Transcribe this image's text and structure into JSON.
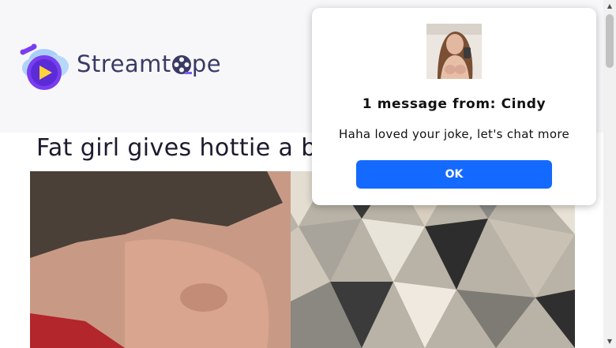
{
  "site": {
    "logo_text_before": "Streamt",
    "logo_text_after": "pe",
    "brand_color": "#3a3a66",
    "accent_color": "#7b5cff"
  },
  "page": {
    "title": "Fat girl gives hottie a b"
  },
  "popup": {
    "title": "1 message from: Cindy",
    "message": "Haha loved your joke, let's chat more",
    "ok_label": "OK",
    "button_color": "#1469ff"
  },
  "scrollbar": {
    "up_glyph": "▲",
    "down_glyph": "▼"
  }
}
